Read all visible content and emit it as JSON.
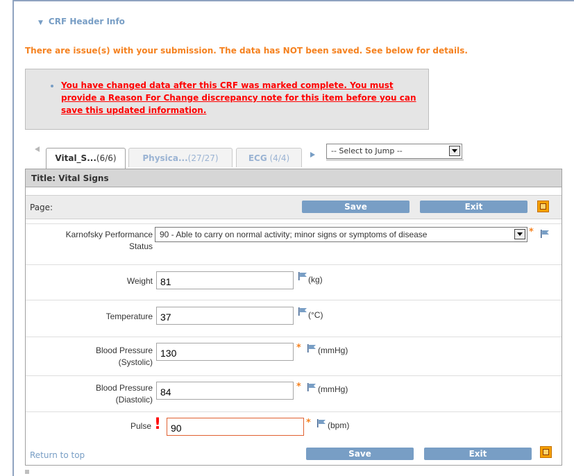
{
  "header": {
    "toggle_label": "CRF Header Info"
  },
  "alert": {
    "message": "There are issue(s) with your submission. The data has NOT been saved. See below for details.",
    "detail": "You have changed data after this CRF was marked complete. You must provide a Reason For Change discrepancy note for this item before you can save this updated information."
  },
  "tabs": [
    {
      "label": "Vital_S...",
      "count": "(6/6)",
      "active": true
    },
    {
      "label": "Physica...",
      "count": "(27/27)",
      "active": false
    },
    {
      "label": "ECG",
      "count": " (4/4)",
      "active": false
    }
  ],
  "jump": {
    "selected": "-- Select to Jump --"
  },
  "section": {
    "title": "Title: Vital Signs",
    "page_label": "Page:",
    "save_label": "Save",
    "exit_label": "Exit",
    "return_top": "Return to top"
  },
  "fields": {
    "karnofsky": {
      "label": "Karnofsky Performance Status",
      "value": "90 - Able to carry on normal activity; minor signs or symptoms of disease",
      "required": "*"
    },
    "weight": {
      "label": "Weight",
      "value": "81",
      "unit": "(kg)"
    },
    "temperature": {
      "label": "Temperature",
      "value": "37",
      "unit": "(°C)"
    },
    "bp_sys": {
      "label": "Blood Pressure (Systolic)",
      "value": "130",
      "unit": "(mmHg)",
      "required": "*"
    },
    "bp_dia": {
      "label": "Blood Pressure (Diastolic)",
      "value": "84",
      "unit": "(mmHg)",
      "required": "*"
    },
    "pulse": {
      "label": "Pulse",
      "value": "90",
      "unit": "(bpm)",
      "required": "*",
      "error_mark": "!"
    }
  },
  "colors": {
    "accent": "#789ec5",
    "warning": "#f58220",
    "error": "#ff0000"
  }
}
